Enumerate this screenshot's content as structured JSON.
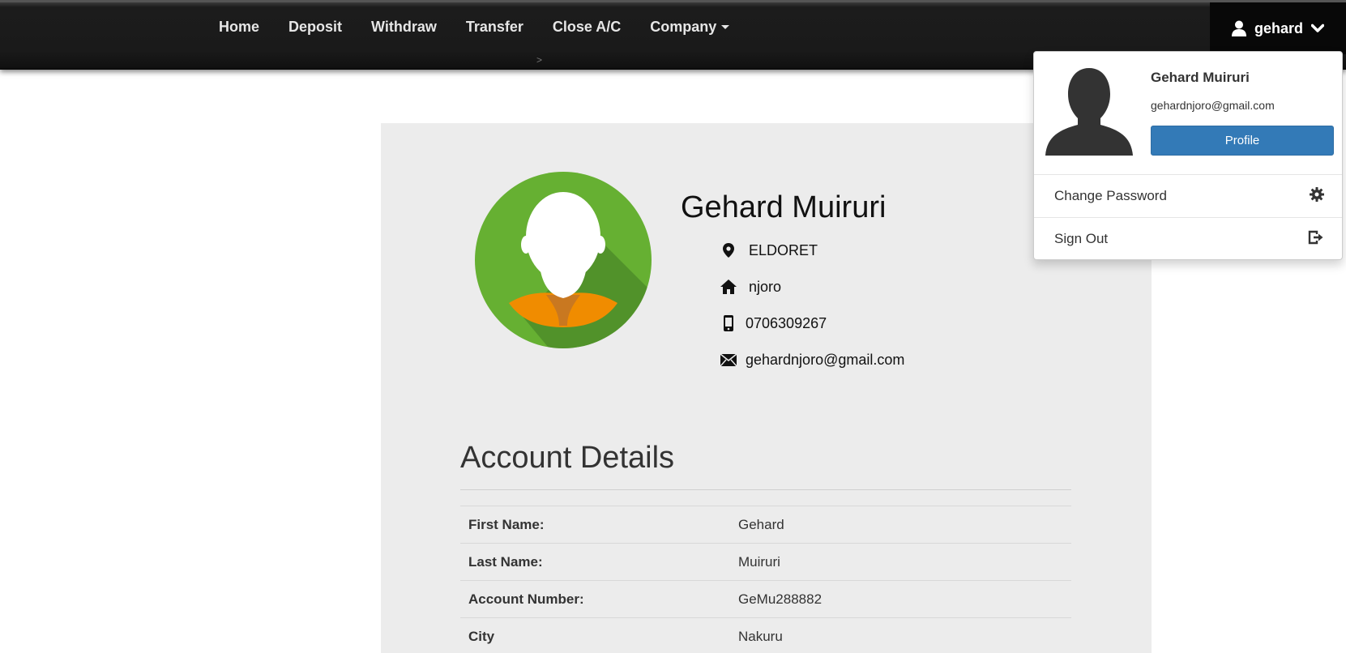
{
  "nav": {
    "links": [
      "Home",
      "Deposit",
      "Withdraw",
      "Transfer",
      "Close A/C",
      "Company"
    ],
    "breadcrumb_separator": ">",
    "user_label": "gehard"
  },
  "dropdown": {
    "name": "Gehard Muiruri",
    "email": "gehardnjoro@gmail.com",
    "profile_button": "Profile",
    "change_password": "Change Password",
    "sign_out": "Sign Out"
  },
  "profile": {
    "name": "Gehard Muiruri",
    "location": "ELDORET",
    "home": "njoro",
    "phone": "0706309267",
    "email": "gehardnjoro@gmail.com"
  },
  "account_details": {
    "title": "Account Details",
    "rows": [
      {
        "label": "First Name:",
        "value": "Gehard"
      },
      {
        "label": "Last Name:",
        "value": "Muiruri"
      },
      {
        "label": "Account Number:",
        "value": "GeMu288882"
      },
      {
        "label": "City",
        "value": "Nakuru"
      }
    ]
  },
  "colors": {
    "navbar": "#1a1a1a",
    "primary_button": "#337ab7",
    "panel_bg": "#ececec",
    "avatar_green": "#66b032",
    "avatar_orange": "#f09000"
  }
}
